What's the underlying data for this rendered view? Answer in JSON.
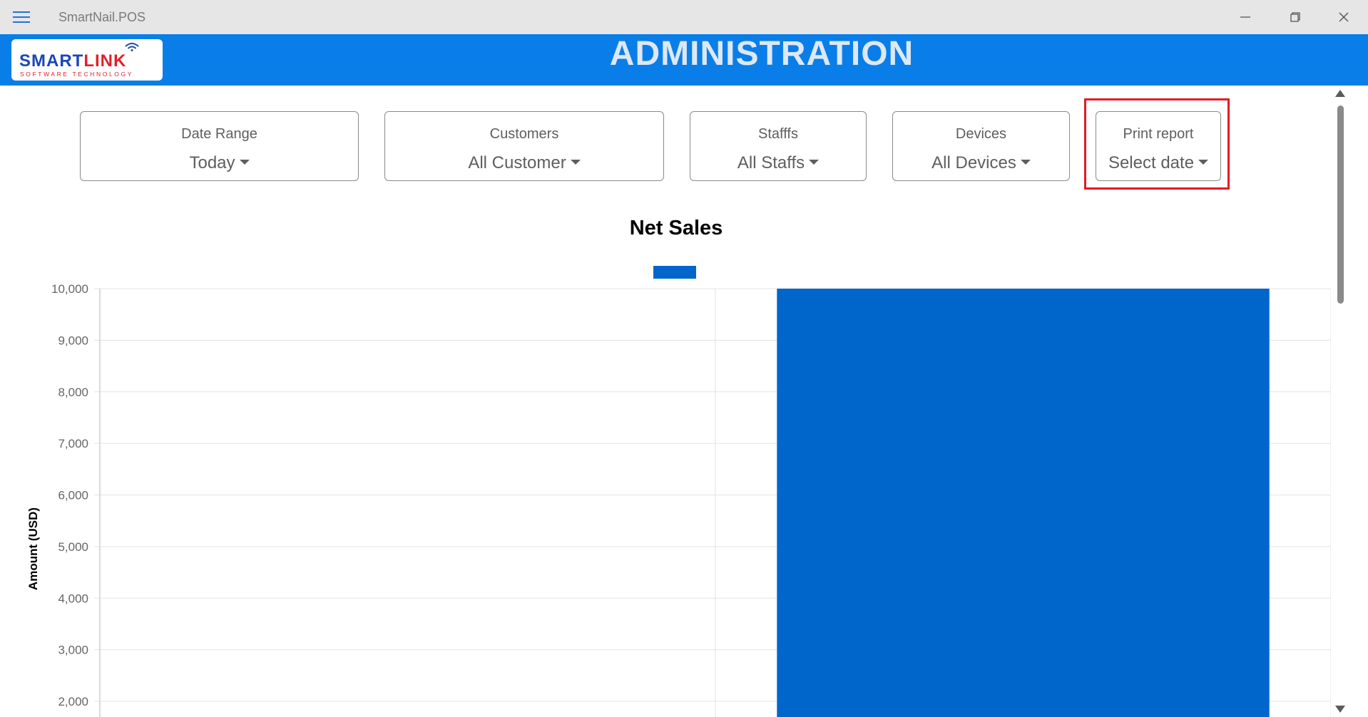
{
  "window": {
    "app_title": "SmartNail.POS",
    "menu_icon": "hamburger-icon",
    "controls": [
      "minimize-icon",
      "restore-icon",
      "close-icon"
    ]
  },
  "header": {
    "brand_primary": "SMART",
    "brand_secondary": "LINK",
    "brand_tagline": "SOFTWARE TECHNOLOGY",
    "title": "ADMINISTRATION",
    "band_color": "#0a7ee8"
  },
  "filters": {
    "date_range": {
      "label": "Date Range",
      "value": "Today"
    },
    "customers": {
      "label": "Customers",
      "value": "All Customer"
    },
    "staffs": {
      "label": "Stafffs",
      "value": "All Staffs"
    },
    "devices": {
      "label": "Devices",
      "value": "All Devices"
    },
    "print_report": {
      "label": "Print report",
      "value": "Select date",
      "highlight_color": "#e21c24"
    }
  },
  "chart_data": {
    "type": "bar",
    "title": "Net Sales",
    "ylabel": "Amount (USD)",
    "xlabel": "",
    "yticks": [
      "2,000",
      "3,000",
      "4,000",
      "5,000",
      "6,000",
      "7,000",
      "8,000",
      "9,000",
      "10,000"
    ],
    "ytick_values": [
      2000,
      3000,
      4000,
      5000,
      6000,
      7000,
      8000,
      9000,
      10000
    ],
    "ylim_visible": [
      2000,
      10000
    ],
    "categories": [
      "",
      ""
    ],
    "series": [
      {
        "color": "#0066cc",
        "values": [
          0,
          10000
        ]
      }
    ],
    "legend": "top-center",
    "grid": true
  }
}
